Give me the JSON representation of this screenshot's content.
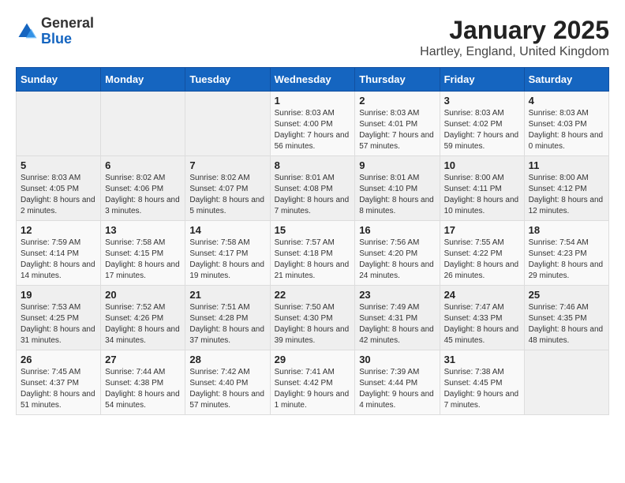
{
  "header": {
    "logo_general": "General",
    "logo_blue": "Blue",
    "month_title": "January 2025",
    "location": "Hartley, England, United Kingdom"
  },
  "weekdays": [
    "Sunday",
    "Monday",
    "Tuesday",
    "Wednesday",
    "Thursday",
    "Friday",
    "Saturday"
  ],
  "weeks": [
    [
      {
        "day": "",
        "info": ""
      },
      {
        "day": "",
        "info": ""
      },
      {
        "day": "",
        "info": ""
      },
      {
        "day": "1",
        "info": "Sunrise: 8:03 AM\nSunset: 4:00 PM\nDaylight: 7 hours and 56 minutes."
      },
      {
        "day": "2",
        "info": "Sunrise: 8:03 AM\nSunset: 4:01 PM\nDaylight: 7 hours and 57 minutes."
      },
      {
        "day": "3",
        "info": "Sunrise: 8:03 AM\nSunset: 4:02 PM\nDaylight: 7 hours and 59 minutes."
      },
      {
        "day": "4",
        "info": "Sunrise: 8:03 AM\nSunset: 4:03 PM\nDaylight: 8 hours and 0 minutes."
      }
    ],
    [
      {
        "day": "5",
        "info": "Sunrise: 8:03 AM\nSunset: 4:05 PM\nDaylight: 8 hours and 2 minutes."
      },
      {
        "day": "6",
        "info": "Sunrise: 8:02 AM\nSunset: 4:06 PM\nDaylight: 8 hours and 3 minutes."
      },
      {
        "day": "7",
        "info": "Sunrise: 8:02 AM\nSunset: 4:07 PM\nDaylight: 8 hours and 5 minutes."
      },
      {
        "day": "8",
        "info": "Sunrise: 8:01 AM\nSunset: 4:08 PM\nDaylight: 8 hours and 7 minutes."
      },
      {
        "day": "9",
        "info": "Sunrise: 8:01 AM\nSunset: 4:10 PM\nDaylight: 8 hours and 8 minutes."
      },
      {
        "day": "10",
        "info": "Sunrise: 8:00 AM\nSunset: 4:11 PM\nDaylight: 8 hours and 10 minutes."
      },
      {
        "day": "11",
        "info": "Sunrise: 8:00 AM\nSunset: 4:12 PM\nDaylight: 8 hours and 12 minutes."
      }
    ],
    [
      {
        "day": "12",
        "info": "Sunrise: 7:59 AM\nSunset: 4:14 PM\nDaylight: 8 hours and 14 minutes."
      },
      {
        "day": "13",
        "info": "Sunrise: 7:58 AM\nSunset: 4:15 PM\nDaylight: 8 hours and 17 minutes."
      },
      {
        "day": "14",
        "info": "Sunrise: 7:58 AM\nSunset: 4:17 PM\nDaylight: 8 hours and 19 minutes."
      },
      {
        "day": "15",
        "info": "Sunrise: 7:57 AM\nSunset: 4:18 PM\nDaylight: 8 hours and 21 minutes."
      },
      {
        "day": "16",
        "info": "Sunrise: 7:56 AM\nSunset: 4:20 PM\nDaylight: 8 hours and 24 minutes."
      },
      {
        "day": "17",
        "info": "Sunrise: 7:55 AM\nSunset: 4:22 PM\nDaylight: 8 hours and 26 minutes."
      },
      {
        "day": "18",
        "info": "Sunrise: 7:54 AM\nSunset: 4:23 PM\nDaylight: 8 hours and 29 minutes."
      }
    ],
    [
      {
        "day": "19",
        "info": "Sunrise: 7:53 AM\nSunset: 4:25 PM\nDaylight: 8 hours and 31 minutes."
      },
      {
        "day": "20",
        "info": "Sunrise: 7:52 AM\nSunset: 4:26 PM\nDaylight: 8 hours and 34 minutes."
      },
      {
        "day": "21",
        "info": "Sunrise: 7:51 AM\nSunset: 4:28 PM\nDaylight: 8 hours and 37 minutes."
      },
      {
        "day": "22",
        "info": "Sunrise: 7:50 AM\nSunset: 4:30 PM\nDaylight: 8 hours and 39 minutes."
      },
      {
        "day": "23",
        "info": "Sunrise: 7:49 AM\nSunset: 4:31 PM\nDaylight: 8 hours and 42 minutes."
      },
      {
        "day": "24",
        "info": "Sunrise: 7:47 AM\nSunset: 4:33 PM\nDaylight: 8 hours and 45 minutes."
      },
      {
        "day": "25",
        "info": "Sunrise: 7:46 AM\nSunset: 4:35 PM\nDaylight: 8 hours and 48 minutes."
      }
    ],
    [
      {
        "day": "26",
        "info": "Sunrise: 7:45 AM\nSunset: 4:37 PM\nDaylight: 8 hours and 51 minutes."
      },
      {
        "day": "27",
        "info": "Sunrise: 7:44 AM\nSunset: 4:38 PM\nDaylight: 8 hours and 54 minutes."
      },
      {
        "day": "28",
        "info": "Sunrise: 7:42 AM\nSunset: 4:40 PM\nDaylight: 8 hours and 57 minutes."
      },
      {
        "day": "29",
        "info": "Sunrise: 7:41 AM\nSunset: 4:42 PM\nDaylight: 9 hours and 1 minute."
      },
      {
        "day": "30",
        "info": "Sunrise: 7:39 AM\nSunset: 4:44 PM\nDaylight: 9 hours and 4 minutes."
      },
      {
        "day": "31",
        "info": "Sunrise: 7:38 AM\nSunset: 4:45 PM\nDaylight: 9 hours and 7 minutes."
      },
      {
        "day": "",
        "info": ""
      }
    ]
  ]
}
